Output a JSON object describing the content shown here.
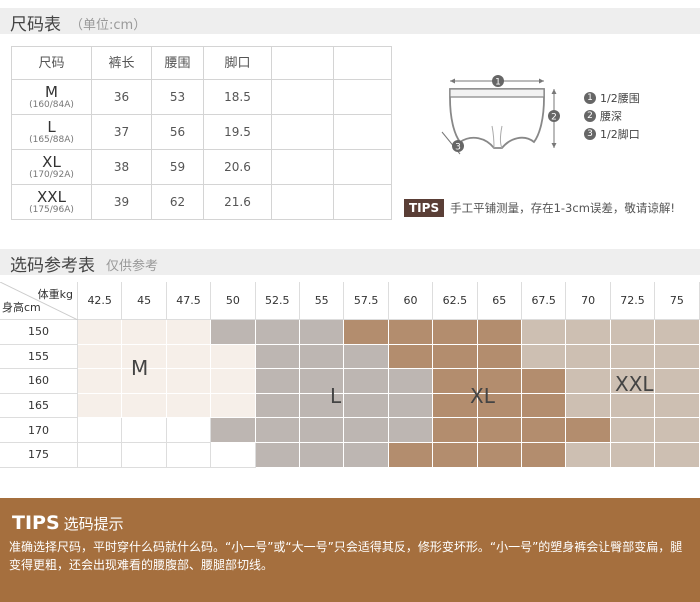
{
  "size_section": {
    "title": "尺码表",
    "unit": "（单位:cm）"
  },
  "size_table": {
    "headers": [
      "尺码",
      "裤长",
      "腰围",
      "脚口",
      "",
      ""
    ],
    "rows": [
      {
        "size": "M",
        "sub": "(160/84A)",
        "length": "36",
        "waist": "53",
        "leg": "18.5"
      },
      {
        "size": "L",
        "sub": "(165/88A)",
        "length": "37",
        "waist": "56",
        "leg": "19.5"
      },
      {
        "size": "XL",
        "sub": "(170/92A)",
        "length": "38",
        "waist": "59",
        "leg": "20.6"
      },
      {
        "size": "XXL",
        "sub": "(175/96A)",
        "length": "39",
        "waist": "62",
        "leg": "21.6"
      }
    ]
  },
  "legend": [
    {
      "num": "1",
      "text": "1/2腰围"
    },
    {
      "num": "2",
      "text": "腰深"
    },
    {
      "num": "3",
      "text": "1/2脚口"
    }
  ],
  "tips_small": {
    "badge": "TIPS",
    "text": "手工平铺测量，存在1-3cm误差，敬请谅解!"
  },
  "ref_section": {
    "title": "选码参考表",
    "sub": "仅供参考"
  },
  "ref_grid": {
    "weight_label": "体重kg",
    "height_label": "身高cm",
    "weights": [
      "42.5",
      "45",
      "47.5",
      "50",
      "52.5",
      "55",
      "57.5",
      "60",
      "62.5",
      "65",
      "67.5",
      "70",
      "72.5",
      "75"
    ],
    "heights": [
      "150",
      "155",
      "160",
      "165",
      "170",
      "175"
    ],
    "zone_labels": {
      "m": "M",
      "l": "L",
      "xl": "XL",
      "xxl": "XXL"
    },
    "colors": {
      "m": "#f6efe9",
      "l": "#bdb6b2",
      "xl": "#b38d6e",
      "xxl": "#cdbfb2",
      "blank": "#ffffff"
    },
    "cells": [
      [
        "m",
        "m",
        "m",
        "l",
        "l",
        "l",
        "xl",
        "xl",
        "xl",
        "xl",
        "xxl",
        "xxl",
        "xxl",
        "xxl"
      ],
      [
        "m",
        "m",
        "m",
        "m",
        "l",
        "l",
        "l",
        "xl",
        "xl",
        "xl",
        "xxl",
        "xxl",
        "xxl",
        "xxl"
      ],
      [
        "m",
        "m",
        "m",
        "m",
        "l",
        "l",
        "l",
        "l",
        "xl",
        "xl",
        "xl",
        "xxl",
        "xxl",
        "xxl"
      ],
      [
        "m",
        "m",
        "m",
        "m",
        "l",
        "l",
        "l",
        "l",
        "xl",
        "xl",
        "xl",
        "xxl",
        "xxl",
        "xxl"
      ],
      [
        "blank",
        "blank",
        "blank",
        "l",
        "l",
        "l",
        "l",
        "l",
        "xl",
        "xl",
        "xl",
        "xl",
        "xxl",
        "xxl"
      ],
      [
        "blank",
        "blank",
        "blank",
        "blank",
        "l",
        "l",
        "l",
        "xl",
        "xl",
        "xl",
        "xl",
        "xxl",
        "xxl",
        "xxl"
      ]
    ]
  },
  "tips_bar": {
    "title_big": "TIPS",
    "title_small": "选码提示",
    "body": "准确选择尺码，平时穿什么码就什么码。“小一号”或“大一号”只会适得其反，修形变坏形。“小一号”的塑身裤会让臀部变扁，腿变得更粗，还会出现难看的腰腹部、腰腿部切线。"
  }
}
